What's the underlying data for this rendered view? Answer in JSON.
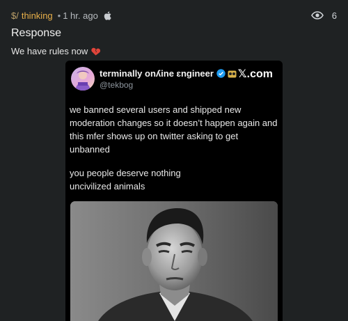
{
  "header": {
    "channel_prefix": "$/",
    "channel_name": "thinking",
    "separator": "•",
    "time_ago": "1 hr. ago",
    "platform_icon": "apple-icon",
    "view_count": "6"
  },
  "post": {
    "title": "Response",
    "body": "We have rules now",
    "body_emoji": "broken-heart-icon"
  },
  "tweet": {
    "display_name": "terminally onʎine ɛngineer",
    "handle": "@tekbog",
    "brand": "𝕏.com",
    "paragraph_1": "we banned several users and shipped new moderation changes so it doesn’t happen again and this mfer shows up on twitter asking to get unbanned",
    "paragraph_2_line_1": "you people deserve nothing",
    "paragraph_2_line_2": "uncivilized animals"
  },
  "colors": {
    "background": "#1f2223",
    "channel_accent": "#e8b04a",
    "verified_blue": "#1d9bf0",
    "heart_red": "#e0453a"
  }
}
